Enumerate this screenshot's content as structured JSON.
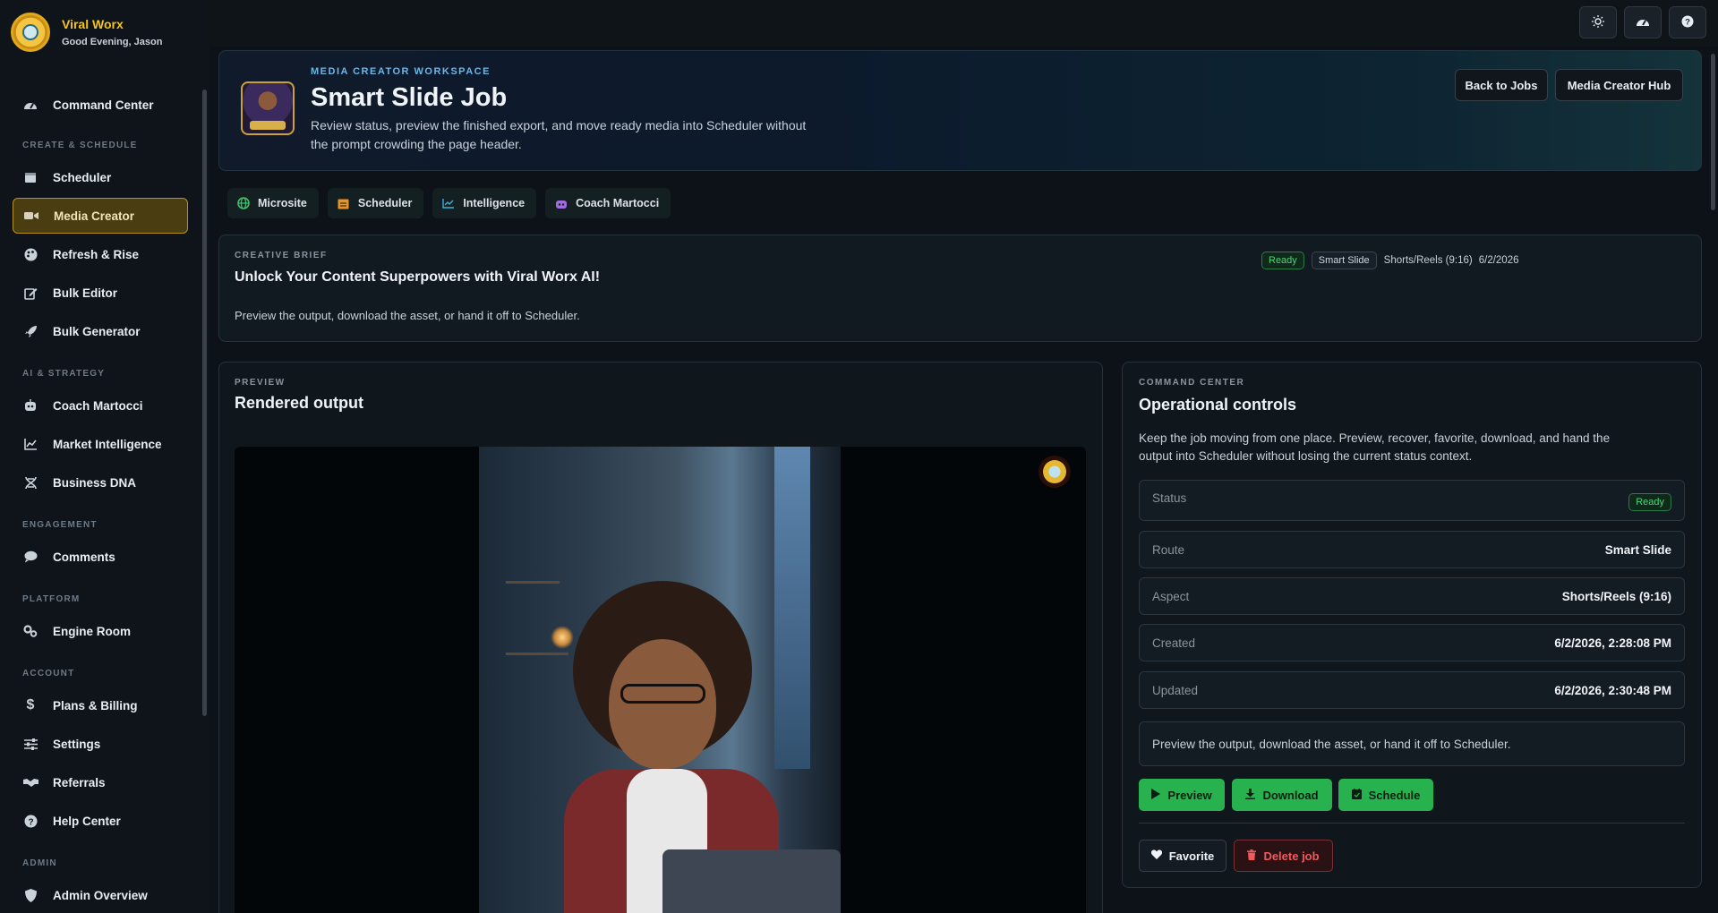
{
  "brand": {
    "name": "Viral Worx",
    "greeting": "Good Evening, Jason"
  },
  "sidebar": {
    "top_items": [
      {
        "label": "Command Center",
        "icon": "dashboard-icon"
      }
    ],
    "sections": [
      {
        "title": "CREATE & SCHEDULE",
        "items": [
          {
            "label": "Scheduler",
            "icon": "calendar-icon"
          },
          {
            "label": "Media Creator",
            "icon": "video-camera-icon",
            "active": true
          },
          {
            "label": "Refresh & Rise",
            "icon": "palette-icon"
          },
          {
            "label": "Bulk Editor",
            "icon": "edit-icon"
          },
          {
            "label": "Bulk Generator",
            "icon": "rocket-icon"
          }
        ]
      },
      {
        "title": "AI & STRATEGY",
        "items": [
          {
            "label": "Coach Martocci",
            "icon": "robot-icon"
          },
          {
            "label": "Market Intelligence",
            "icon": "chart-line-icon"
          },
          {
            "label": "Business DNA",
            "icon": "dna-icon"
          }
        ]
      },
      {
        "title": "ENGAGEMENT",
        "items": [
          {
            "label": "Comments",
            "icon": "comment-icon"
          }
        ]
      },
      {
        "title": "PLATFORM",
        "items": [
          {
            "label": "Engine Room",
            "icon": "gears-icon"
          }
        ]
      },
      {
        "title": "ACCOUNT",
        "items": [
          {
            "label": "Plans & Billing",
            "icon": "dollar-icon"
          },
          {
            "label": "Settings",
            "icon": "sliders-icon"
          },
          {
            "label": "Referrals",
            "icon": "handshake-icon"
          },
          {
            "label": "Help Center",
            "icon": "question-circle-icon"
          }
        ]
      },
      {
        "title": "ADMIN",
        "items": [
          {
            "label": "Admin Overview",
            "icon": "shield-icon"
          }
        ]
      }
    ]
  },
  "topbar": {
    "buttons": [
      "sun-icon",
      "gauge-icon",
      "question-icon"
    ]
  },
  "hero": {
    "kicker": "MEDIA CREATOR WORKSPACE",
    "title": "Smart Slide Job",
    "description": "Review status, preview the finished export, and move ready media into Scheduler without the prompt crowding the page header.",
    "back_button": "Back to Jobs",
    "hub_button": "Media Creator Hub"
  },
  "quick_links": [
    {
      "label": "Microsite",
      "icon": "globe-icon",
      "color": "#3fbf6a"
    },
    {
      "label": "Scheduler",
      "icon": "calendar-icon",
      "color": "#e8932a"
    },
    {
      "label": "Intelligence",
      "icon": "chart-line-icon",
      "color": "#3fb0d9"
    },
    {
      "label": "Coach Martocci",
      "icon": "robot-icon",
      "color": "#a06ce0"
    }
  ],
  "brief": {
    "kicker": "CREATIVE BRIEF",
    "title": "Unlock Your Content Superpowers with Viral Worx AI!",
    "description": "Preview the output, download the asset, or hand it off to Scheduler.",
    "status": "Ready",
    "route": "Smart Slide",
    "aspect": "Shorts/Reels (9:16)",
    "date": "6/2/2026"
  },
  "preview": {
    "kicker": "PREVIEW",
    "title": "Rendered output"
  },
  "command_center": {
    "kicker": "COMMAND CENTER",
    "title": "Operational controls",
    "description": "Keep the job moving from one place. Preview, recover, favorite, download, and hand the output into Scheduler without losing the current status context.",
    "fields": {
      "status_label": "Status",
      "status_value": "Ready",
      "route_label": "Route",
      "route_value": "Smart Slide",
      "aspect_label": "Aspect",
      "aspect_value": "Shorts/Reels (9:16)",
      "created_label": "Created",
      "created_value": "6/2/2026, 2:28:08 PM",
      "updated_label": "Updated",
      "updated_value": "6/2/2026, 2:30:48 PM"
    },
    "note": "Preview the output, download the asset, or hand it off to Scheduler.",
    "actions": {
      "preview": "Preview",
      "download": "Download",
      "schedule": "Schedule",
      "favorite": "Favorite",
      "delete": "Delete job"
    }
  },
  "colors": {
    "accent": "#f5c518",
    "success": "#27b24f",
    "danger": "#f0585c",
    "link": "#6cb6e8"
  }
}
